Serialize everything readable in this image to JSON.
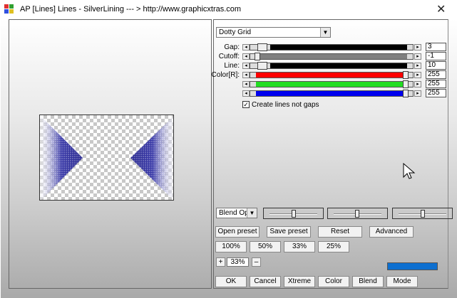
{
  "window": {
    "title": "AP [Lines]  Lines - SilverLining    --- > http://www.graphicxtras.com",
    "close_glyph": "✕"
  },
  "main_dropdown": {
    "value": "Dotty Grid"
  },
  "sliders": [
    {
      "label": "Gap:",
      "value": "3",
      "color": "#000000"
    },
    {
      "label": "Cutoff:",
      "value": "-1",
      "color": "#808080"
    },
    {
      "label": "Line:",
      "value": "10",
      "color": "#000000"
    },
    {
      "label": "Color[R]:",
      "value": "255",
      "color": "#ff0000"
    },
    {
      "label": "",
      "value": "255",
      "color": "#22dd22"
    },
    {
      "label": "",
      "value": "255",
      "color": "#0000ee"
    }
  ],
  "checkbox": {
    "label": "Create lines not gaps",
    "checked_glyph": "✓"
  },
  "blend_dropdown": {
    "value": "Blend Optio"
  },
  "color_bars": [
    {
      "name": "red",
      "color": "#ff0000"
    },
    {
      "name": "green",
      "color": "#00ee00"
    },
    {
      "name": "blue",
      "color": "#0000ff"
    }
  ],
  "preset_buttons": [
    "Open preset",
    "Save preset",
    "Reset",
    "Advanced"
  ],
  "zoom_buttons": [
    "100%",
    "50%",
    "33%",
    "25%"
  ],
  "zoom": {
    "plus": "+",
    "value": "33%",
    "minus": "–"
  },
  "bottom_buttons": [
    "OK",
    "Cancel",
    "Xtreme",
    "Color",
    "Blend",
    "Mode"
  ],
  "accent_color": "#0d6fd0"
}
